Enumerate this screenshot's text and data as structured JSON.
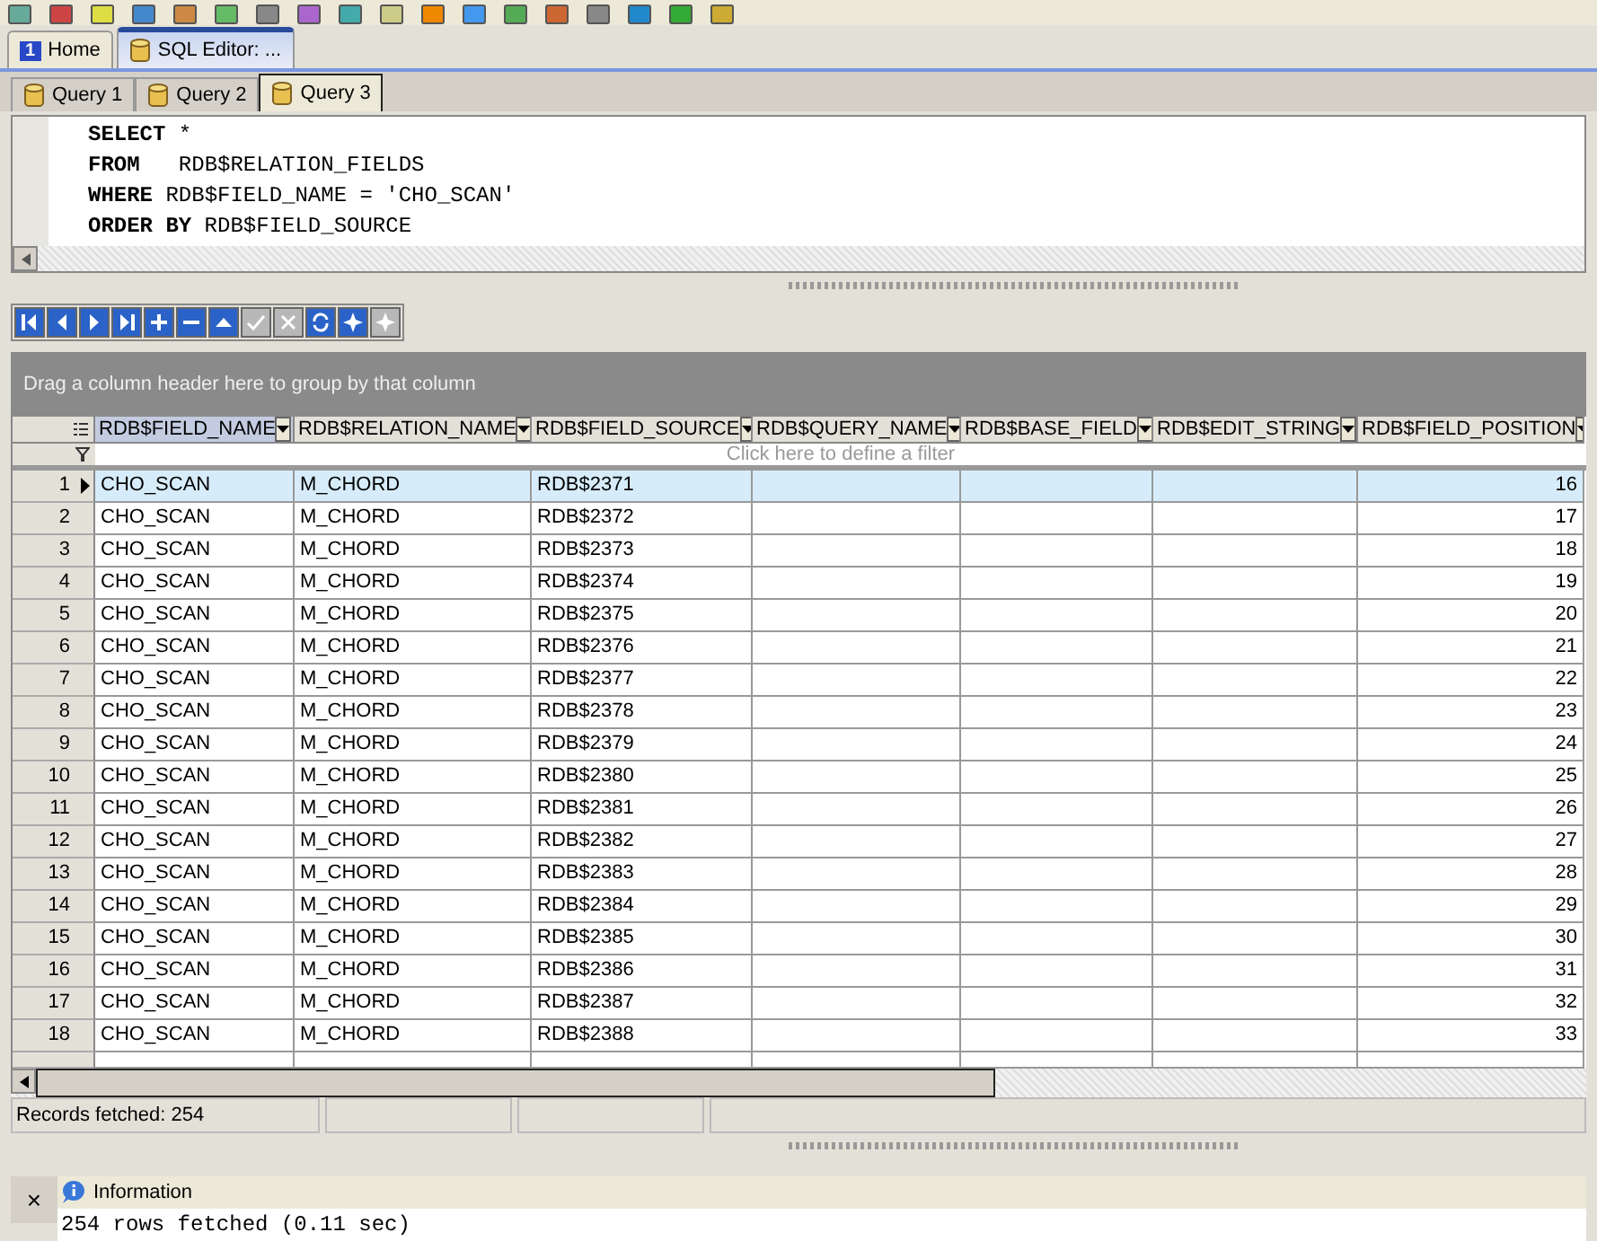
{
  "doc_tabs": [
    {
      "badge": "1",
      "label": "Home",
      "selected": false
    },
    {
      "label": "SQL Editor: ...",
      "selected": true
    }
  ],
  "query_tabs": [
    {
      "label": "Query 1",
      "selected": false
    },
    {
      "label": "Query 2",
      "selected": false
    },
    {
      "label": "Query 3",
      "selected": true
    }
  ],
  "sql_lines": [
    "**SELECT** *",
    "**FROM**   RDB$RELATION_FIELDS",
    "**WHERE** RDB$FIELD_NAME = 'CHO_SCAN'",
    "**ORDER BY** RDB$FIELD_SOURCE"
  ],
  "navigator": [
    {
      "kind": "first",
      "disabled": false
    },
    {
      "kind": "prior",
      "disabled": false
    },
    {
      "kind": "next",
      "disabled": false
    },
    {
      "kind": "last",
      "disabled": false
    },
    {
      "kind": "insert",
      "disabled": false
    },
    {
      "kind": "delete",
      "disabled": false
    },
    {
      "kind": "edit",
      "disabled": false
    },
    {
      "kind": "post",
      "disabled": true
    },
    {
      "kind": "cancel",
      "disabled": true
    },
    {
      "kind": "refresh",
      "disabled": false
    },
    {
      "kind": "star",
      "disabled": false
    },
    {
      "kind": "star",
      "disabled": true
    }
  ],
  "group_panel": {
    "hint": "Drag a column header here to group by that column"
  },
  "table": {
    "columns": [
      "RDB$FIELD_NAME",
      "RDB$RELATION_NAME",
      "RDB$FIELD_SOURCE",
      "RDB$QUERY_NAME",
      "RDB$BASE_FIELD",
      "RDB$EDIT_STRING",
      "RDB$FIELD_POSITION"
    ],
    "filter_hint": "Click here to define a filter",
    "rows": [
      {
        "num": "1",
        "selected": true,
        "cells": [
          "CHO_SCAN",
          "M_CHORD",
          "RDB$2371",
          "",
          "",
          "",
          "16"
        ]
      },
      {
        "num": "2",
        "selected": false,
        "cells": [
          "CHO_SCAN",
          "M_CHORD",
          "RDB$2372",
          "",
          "",
          "",
          "17"
        ]
      },
      {
        "num": "3",
        "selected": false,
        "cells": [
          "CHO_SCAN",
          "M_CHORD",
          "RDB$2373",
          "",
          "",
          "",
          "18"
        ]
      },
      {
        "num": "4",
        "selected": false,
        "cells": [
          "CHO_SCAN",
          "M_CHORD",
          "RDB$2374",
          "",
          "",
          "",
          "19"
        ]
      },
      {
        "num": "5",
        "selected": false,
        "cells": [
          "CHO_SCAN",
          "M_CHORD",
          "RDB$2375",
          "",
          "",
          "",
          "20"
        ]
      },
      {
        "num": "6",
        "selected": false,
        "cells": [
          "CHO_SCAN",
          "M_CHORD",
          "RDB$2376",
          "",
          "",
          "",
          "21"
        ]
      },
      {
        "num": "7",
        "selected": false,
        "cells": [
          "CHO_SCAN",
          "M_CHORD",
          "RDB$2377",
          "",
          "",
          "",
          "22"
        ]
      },
      {
        "num": "8",
        "selected": false,
        "cells": [
          "CHO_SCAN",
          "M_CHORD",
          "RDB$2378",
          "",
          "",
          "",
          "23"
        ]
      },
      {
        "num": "9",
        "selected": false,
        "cells": [
          "CHO_SCAN",
          "M_CHORD",
          "RDB$2379",
          "",
          "",
          "",
          "24"
        ]
      },
      {
        "num": "10",
        "selected": false,
        "cells": [
          "CHO_SCAN",
          "M_CHORD",
          "RDB$2380",
          "",
          "",
          "",
          "25"
        ]
      },
      {
        "num": "11",
        "selected": false,
        "cells": [
          "CHO_SCAN",
          "M_CHORD",
          "RDB$2381",
          "",
          "",
          "",
          "26"
        ]
      },
      {
        "num": "12",
        "selected": false,
        "cells": [
          "CHO_SCAN",
          "M_CHORD",
          "RDB$2382",
          "",
          "",
          "",
          "27"
        ]
      },
      {
        "num": "13",
        "selected": false,
        "cells": [
          "CHO_SCAN",
          "M_CHORD",
          "RDB$2383",
          "",
          "",
          "",
          "28"
        ]
      },
      {
        "num": "14",
        "selected": false,
        "cells": [
          "CHO_SCAN",
          "M_CHORD",
          "RDB$2384",
          "",
          "",
          "",
          "29"
        ]
      },
      {
        "num": "15",
        "selected": false,
        "cells": [
          "CHO_SCAN",
          "M_CHORD",
          "RDB$2385",
          "",
          "",
          "",
          "30"
        ]
      },
      {
        "num": "16",
        "selected": false,
        "cells": [
          "CHO_SCAN",
          "M_CHORD",
          "RDB$2386",
          "",
          "",
          "",
          "31"
        ]
      },
      {
        "num": "17",
        "selected": false,
        "cells": [
          "CHO_SCAN",
          "M_CHORD",
          "RDB$2387",
          "",
          "",
          "",
          "32"
        ]
      },
      {
        "num": "18",
        "selected": false,
        "cells": [
          "CHO_SCAN",
          "M_CHORD",
          "RDB$2388",
          "",
          "",
          "",
          "33"
        ]
      }
    ]
  },
  "status_bar": [
    "Records fetched: 254"
  ],
  "info_panel": {
    "close": "×",
    "title": "Information",
    "message": "254 rows fetched (0.11 sec)"
  }
}
